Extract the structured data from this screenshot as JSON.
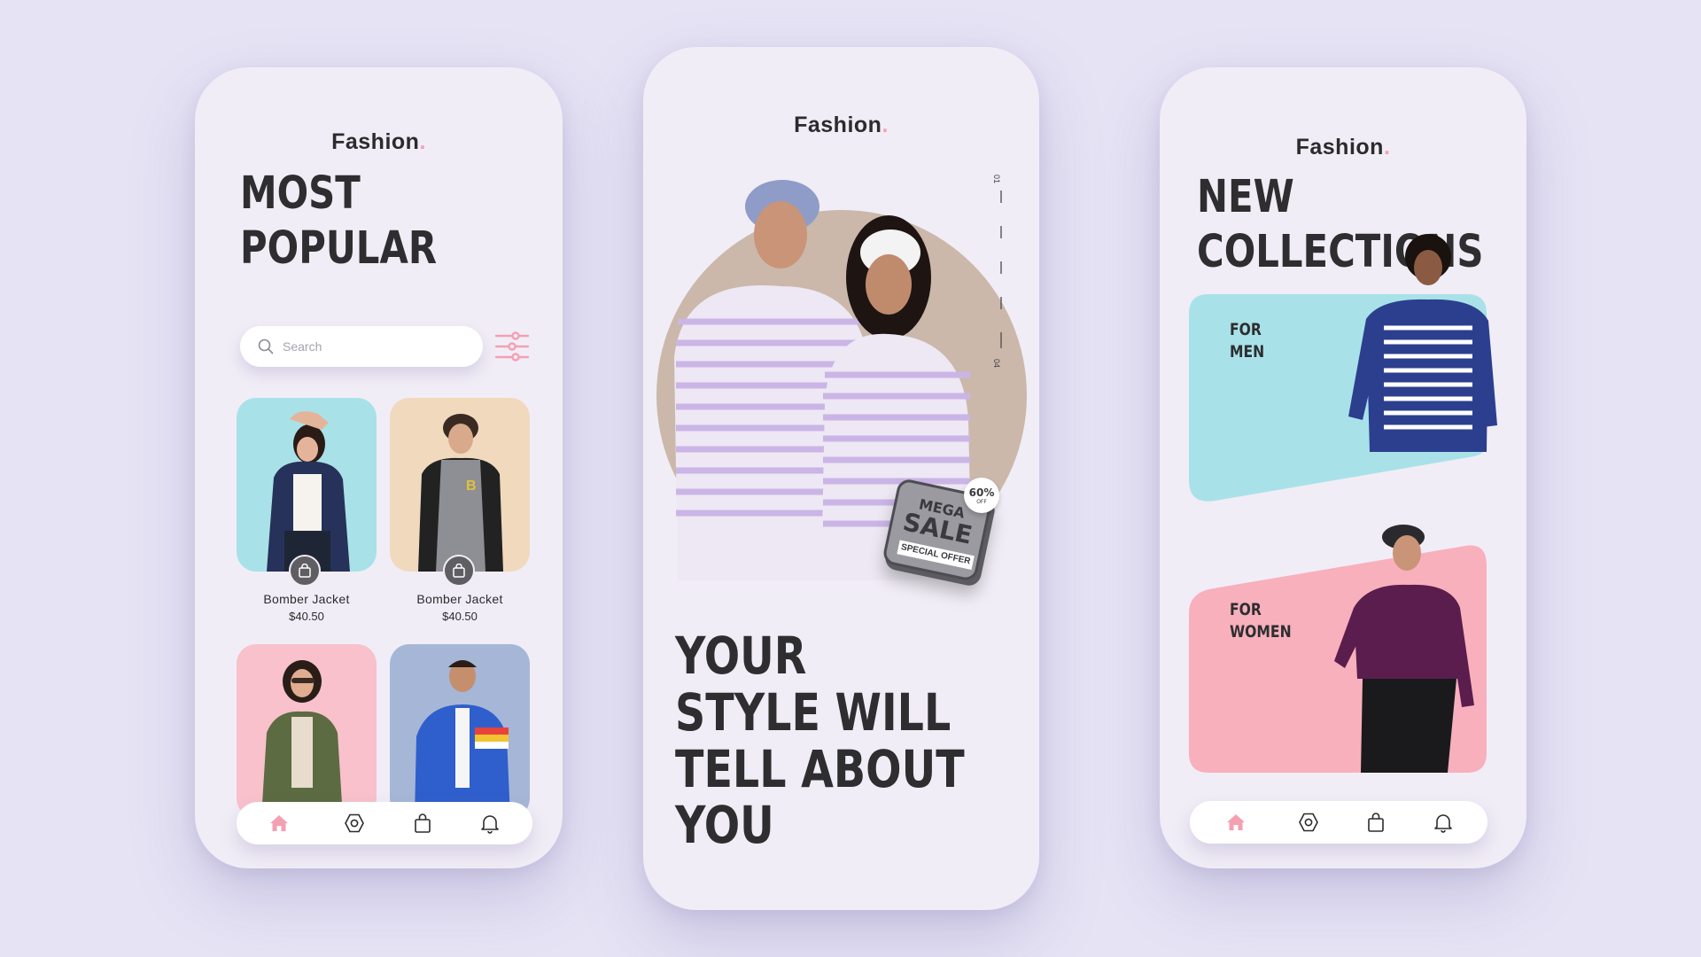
{
  "colors": {
    "background": "#e6e3f5",
    "phone": "#f1edf6",
    "accent_pink": "#f4a0b3",
    "card_cyan": "#a8e2e8",
    "card_beige": "#f0d9bd",
    "card_pink": "#f8c1cc",
    "card_blue": "#a6b6d6",
    "hero_circle": "#cbb8ab",
    "text_dark": "#2e2e30"
  },
  "left_screen": {
    "brand": "Fashion",
    "title_line1": "MOST",
    "title_line2": "POPULAR",
    "search": {
      "placeholder": "Search",
      "icon": "search-icon"
    },
    "filter_icon": "filter-sliders-icon",
    "products": [
      {
        "name": "Bomber Jacket",
        "price": "$40.50",
        "bg": "cyan"
      },
      {
        "name": "Bomber Jacket",
        "price": "$40.50",
        "bg": "beige"
      },
      {
        "name": "",
        "price": "",
        "bg": "pink"
      },
      {
        "name": "",
        "price": "",
        "bg": "blue"
      }
    ],
    "nav": [
      "home-icon",
      "explore-icon",
      "bag-icon",
      "bell-icon"
    ],
    "active_nav": "home-icon"
  },
  "center_screen": {
    "brand": "Fashion",
    "slide_start": "01",
    "slide_end": "04",
    "badge": {
      "line1": "MEGA",
      "line2": "SALE",
      "ribbon": "SPECIAL OFFER",
      "percent": "60%",
      "off": "OFF"
    },
    "headline": [
      "YOUR",
      "STYLE WILL",
      "TELL ABOUT",
      "YOU"
    ]
  },
  "right_screen": {
    "brand": "Fashion",
    "title_line1": "NEW",
    "title_line2": "COLLECTIONS",
    "categories": [
      {
        "line1": "FOR",
        "line2": "MEN",
        "bg": "cyan"
      },
      {
        "line1": "FOR",
        "line2": "WOMEN",
        "bg": "pink"
      }
    ],
    "nav": [
      "home-icon",
      "explore-icon",
      "bag-icon",
      "bell-icon"
    ],
    "active_nav": "home-icon"
  }
}
